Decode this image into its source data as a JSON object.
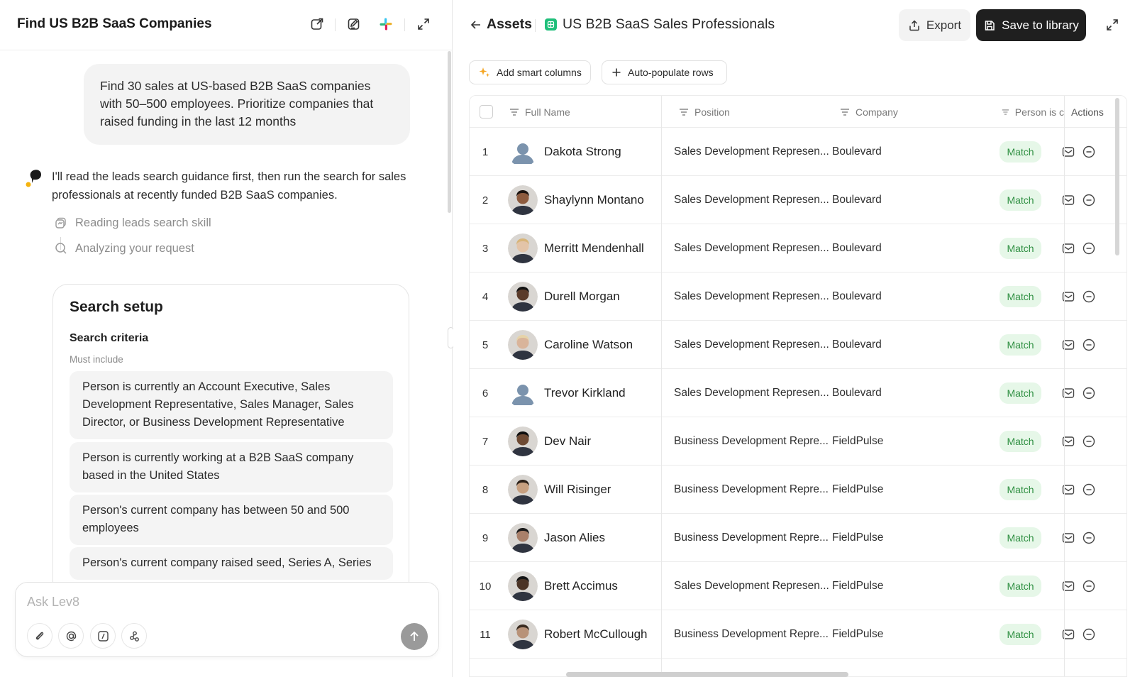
{
  "left": {
    "title": "Find US B2B SaaS Companies",
    "user_message": "Find 30 sales at US-based B2B SaaS companies with 50–500 employees. Prioritize companies that raised funding in the last 12 months",
    "assistant_message": "I'll read the leads search guidance first, then run the search for sales professionals at recently funded B2B SaaS companies.",
    "steps": [
      "Reading leads search skill",
      "Analyzing your request"
    ],
    "setup": {
      "title": "Search setup",
      "criteria_title": "Search criteria",
      "must_include": "Must include",
      "criteria": [
        "Person is currently an Account Executive, Sales Development Representative, Sales Manager, Sales Director, or Business Development Representative",
        "Person is currently working at a B2B SaaS company based in the United States",
        "Person's current company has between 50 and 500 employees",
        "Person's current company raised seed, Series A, Series"
      ]
    },
    "composer": {
      "placeholder": "Ask Lev8"
    }
  },
  "right": {
    "breadcrumb": "Assets",
    "title": "US B2B SaaS Sales Professionals",
    "export_label": "Export",
    "save_label": "Save to library",
    "add_smart_columns": "Add smart columns",
    "auto_populate": "Auto-populate rows",
    "columns": [
      "Full Name",
      "Position",
      "Company",
      "Person is c",
      "Actions"
    ],
    "rows": [
      {
        "n": "1",
        "name": "Dakota Strong",
        "position": "Sales Development Represen...",
        "company": "Boulevard",
        "status": "Match",
        "avatar": "placeholder"
      },
      {
        "n": "2",
        "name": "Shaylynn Montano",
        "position": "Sales Development Represen...",
        "company": "Boulevard",
        "status": "Match",
        "avatar": "photo"
      },
      {
        "n": "3",
        "name": "Merritt Mendenhall",
        "position": "Sales Development Represen...",
        "company": "Boulevard",
        "status": "Match",
        "avatar": "photo"
      },
      {
        "n": "4",
        "name": "Durell Morgan",
        "position": "Sales Development Represen...",
        "company": "Boulevard",
        "status": "Match",
        "avatar": "photo"
      },
      {
        "n": "5",
        "name": "Caroline Watson",
        "position": "Sales Development Represen...",
        "company": "Boulevard",
        "status": "Match",
        "avatar": "photo"
      },
      {
        "n": "6",
        "name": "Trevor Kirkland",
        "position": "Sales Development Represen...",
        "company": "Boulevard",
        "status": "Match",
        "avatar": "placeholder"
      },
      {
        "n": "7",
        "name": "Dev Nair",
        "position": "Business Development Repre...",
        "company": "FieldPulse",
        "status": "Match",
        "avatar": "photo"
      },
      {
        "n": "8",
        "name": "Will Risinger",
        "position": "Business Development Repre...",
        "company": "FieldPulse",
        "status": "Match",
        "avatar": "photo"
      },
      {
        "n": "9",
        "name": "Jason Alies",
        "position": "Business Development Repre...",
        "company": "FieldPulse",
        "status": "Match",
        "avatar": "photo"
      },
      {
        "n": "10",
        "name": "Brett Accimus",
        "position": "Sales Development Represen...",
        "company": "FieldPulse",
        "status": "Match",
        "avatar": "photo"
      },
      {
        "n": "11",
        "name": "Robert McCullough",
        "position": "Business Development Repre...",
        "company": "FieldPulse",
        "status": "Match",
        "avatar": "photo"
      }
    ]
  },
  "colors": {
    "match_bg": "#e6f7e8",
    "match_text": "#2e8f41",
    "brand_dark": "#1f1f1f",
    "asset_icon": "#1fbf7a"
  },
  "icons": [
    "share-icon",
    "edit-icon",
    "slack-icon",
    "expand-icon",
    "back-arrow-icon",
    "upload-icon",
    "save-icon",
    "sparkle-icon",
    "plus-icon",
    "sort-icon",
    "mail-icon",
    "minus-circle-icon",
    "paperclip-icon",
    "at-icon",
    "slash-command-icon",
    "workflow-icon",
    "send-arrow-icon"
  ]
}
